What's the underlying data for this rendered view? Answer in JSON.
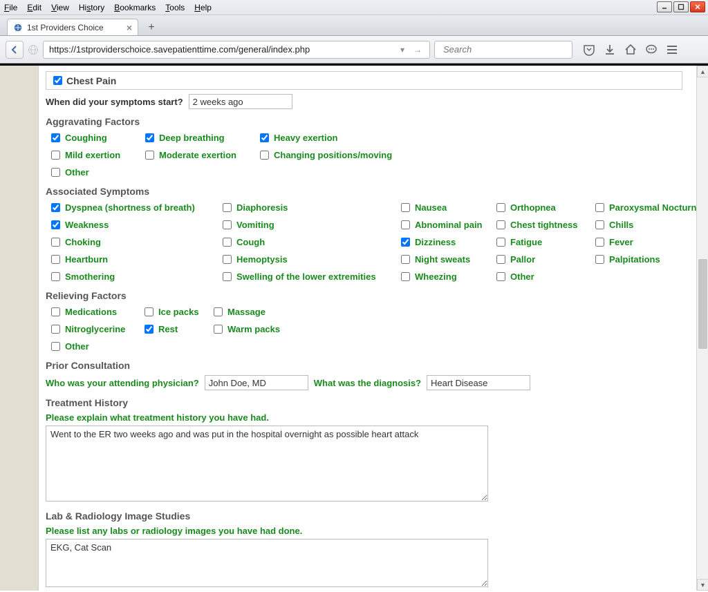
{
  "menubar": {
    "items": [
      "File",
      "Edit",
      "View",
      "History",
      "Bookmarks",
      "Tools",
      "Help"
    ]
  },
  "tab": {
    "title": "1st Providers Choice"
  },
  "url": "https://1stproviderschoice.savepatienttime.com/general/index.php",
  "search": {
    "placeholder": "Search"
  },
  "form": {
    "chest_pain_label": "Chest Pain",
    "chest_pain_checked": true,
    "symptoms_start_label": "When did your symptoms start?",
    "symptoms_start_value": "2 weeks ago",
    "aggravating_heading": "Aggravating Factors",
    "aggravating": [
      {
        "label": "Coughing",
        "checked": true
      },
      {
        "label": "Deep breathing",
        "checked": true
      },
      {
        "label": "Heavy exertion",
        "checked": true
      },
      {
        "label": "Mild exertion",
        "checked": false
      },
      {
        "label": "Moderate exertion",
        "checked": false
      },
      {
        "label": "Changing positions/moving",
        "checked": false
      },
      {
        "label": "Other",
        "checked": false
      }
    ],
    "associated_heading": "Associated Symptoms",
    "associated": [
      {
        "label": "Dyspnea (shortness of breath)",
        "checked": true
      },
      {
        "label": "Diaphoresis",
        "checked": false
      },
      {
        "label": "Nausea",
        "checked": false
      },
      {
        "label": "Orthopnea",
        "checked": false
      },
      {
        "label": "Paroxysmal Nocturnal D",
        "checked": false
      },
      {
        "label": "Weakness",
        "checked": true
      },
      {
        "label": "Vomiting",
        "checked": false
      },
      {
        "label": "Abnominal pain",
        "checked": false
      },
      {
        "label": "Chest tightness",
        "checked": false
      },
      {
        "label": "Chills",
        "checked": false
      },
      {
        "label": "Choking",
        "checked": false
      },
      {
        "label": "Cough",
        "checked": false
      },
      {
        "label": "Dizziness",
        "checked": true
      },
      {
        "label": "Fatigue",
        "checked": false
      },
      {
        "label": "Fever",
        "checked": false
      },
      {
        "label": "Heartburn",
        "checked": false
      },
      {
        "label": "Hemoptysis",
        "checked": false
      },
      {
        "label": "Night sweats",
        "checked": false
      },
      {
        "label": "Pallor",
        "checked": false
      },
      {
        "label": "Palpitations",
        "checked": false
      },
      {
        "label": "Smothering",
        "checked": false
      },
      {
        "label": "Swelling of the lower extremities",
        "checked": false
      },
      {
        "label": "Wheezing",
        "checked": false
      },
      {
        "label": "Other",
        "checked": false
      }
    ],
    "relieving_heading": "Relieving Factors",
    "relieving": [
      {
        "label": "Medications",
        "checked": false
      },
      {
        "label": "Ice packs",
        "checked": false
      },
      {
        "label": "Massage",
        "checked": false
      },
      {
        "label": "Nitroglycerine",
        "checked": false
      },
      {
        "label": "Rest",
        "checked": true
      },
      {
        "label": "Warm packs",
        "checked": false
      },
      {
        "label": "Other",
        "checked": false
      }
    ],
    "prior_heading": "Prior Consultation",
    "physician_label": "Who was your attending physician?",
    "physician_value": "John Doe, MD",
    "diagnosis_label": "What was the diagnosis?",
    "diagnosis_value": "Heart Disease",
    "treatment_heading": "Treatment History",
    "treatment_prompt": "Please explain what treatment history you have had.",
    "treatment_value": "Went to the ER two weeks ago and was put in the hospital overnight as possible heart attack",
    "lab_heading": "Lab & Radiology Image Studies",
    "lab_prompt": "Please list any labs or radiology images you have had done.",
    "lab_value": "EKG, Cat Scan"
  }
}
